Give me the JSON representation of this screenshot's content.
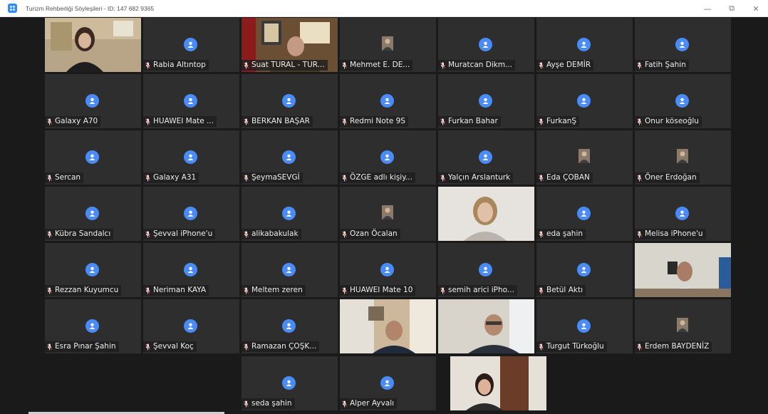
{
  "window": {
    "title": "Turizm Rehberliği Söyleşileri - ID: 147 682 9365",
    "controls": {
      "minimize": "—",
      "maximize": "⧉",
      "close": "✕"
    }
  },
  "colors": {
    "accent": "#2d8cff",
    "avatar": "#4a8cf7",
    "tile_bg": "#2e2e2e",
    "gallery_bg": "#1a1a1a"
  },
  "participants": [
    {
      "name": "",
      "kind": "video-woman"
    },
    {
      "name": "Rabia Altıntop",
      "kind": "avatar"
    },
    {
      "name": "Suat TURAL - TUR...",
      "kind": "video-office"
    },
    {
      "name": "Mehmet E. DE...",
      "kind": "small-photo"
    },
    {
      "name": "Muratcan Dikm...",
      "kind": "avatar"
    },
    {
      "name": "Ayşe DEMİR",
      "kind": "avatar"
    },
    {
      "name": "Fatih Şahin",
      "kind": "avatar"
    },
    {
      "name": "Galaxy A70",
      "kind": "avatar"
    },
    {
      "name": "HUAWEI Mate ...",
      "kind": "avatar"
    },
    {
      "name": "BERKAN BAŞAR",
      "kind": "avatar"
    },
    {
      "name": "Redmi Note 9S",
      "kind": "avatar"
    },
    {
      "name": "Furkan Bahar",
      "kind": "avatar"
    },
    {
      "name": "FurkanŞ",
      "kind": "avatar"
    },
    {
      "name": "Onur köseoğlu",
      "kind": "avatar"
    },
    {
      "name": "Sercan",
      "kind": "avatar"
    },
    {
      "name": "Galaxy A31",
      "kind": "avatar"
    },
    {
      "name": "ŞeymaSEVGİ",
      "kind": "avatar"
    },
    {
      "name": "ÖZGE adlı kişiy...",
      "kind": "avatar"
    },
    {
      "name": "Yalçın Arslanturk",
      "kind": "avatar"
    },
    {
      "name": "Eda ÇOBAN",
      "kind": "small-photo"
    },
    {
      "name": "Öner Erdoğan",
      "kind": "small-photo"
    },
    {
      "name": "Kübra Sandalcı",
      "kind": "avatar"
    },
    {
      "name": "Şevval iPhone'u",
      "kind": "avatar"
    },
    {
      "name": "alikabakulak",
      "kind": "avatar"
    },
    {
      "name": "Ozan Öcalan",
      "kind": "small-photo"
    },
    {
      "name": "",
      "kind": "video-woman2"
    },
    {
      "name": "eda şahin",
      "kind": "avatar"
    },
    {
      "name": "Melisa iPhone'u",
      "kind": "avatar"
    },
    {
      "name": "Rezzan Kuyumcu",
      "kind": "avatar"
    },
    {
      "name": "Neriman KAYA",
      "kind": "avatar"
    },
    {
      "name": "Meltem zeren",
      "kind": "avatar"
    },
    {
      "name": "HUAWEI Mate 10",
      "kind": "avatar"
    },
    {
      "name": "semih arici iPho...",
      "kind": "avatar"
    },
    {
      "name": "Betül Aktı",
      "kind": "avatar"
    },
    {
      "name": "",
      "kind": "video-man-office"
    },
    {
      "name": "Esra Pınar Şahin",
      "kind": "avatar"
    },
    {
      "name": "Şevval Koç",
      "kind": "avatar"
    },
    {
      "name": "Ramazan ÇOŞK...",
      "kind": "avatar"
    },
    {
      "name": "",
      "kind": "video-man-room"
    },
    {
      "name": "",
      "kind": "video-man-glasses"
    },
    {
      "name": "Turgut Türkoğlu",
      "kind": "avatar"
    },
    {
      "name": "Erdem BAYDENİZ",
      "kind": "small-photo"
    },
    {
      "name": "seda şahin",
      "kind": "avatar"
    },
    {
      "name": "Alper Ayvalı",
      "kind": "avatar"
    },
    {
      "name": "",
      "kind": "video-woman3"
    }
  ]
}
